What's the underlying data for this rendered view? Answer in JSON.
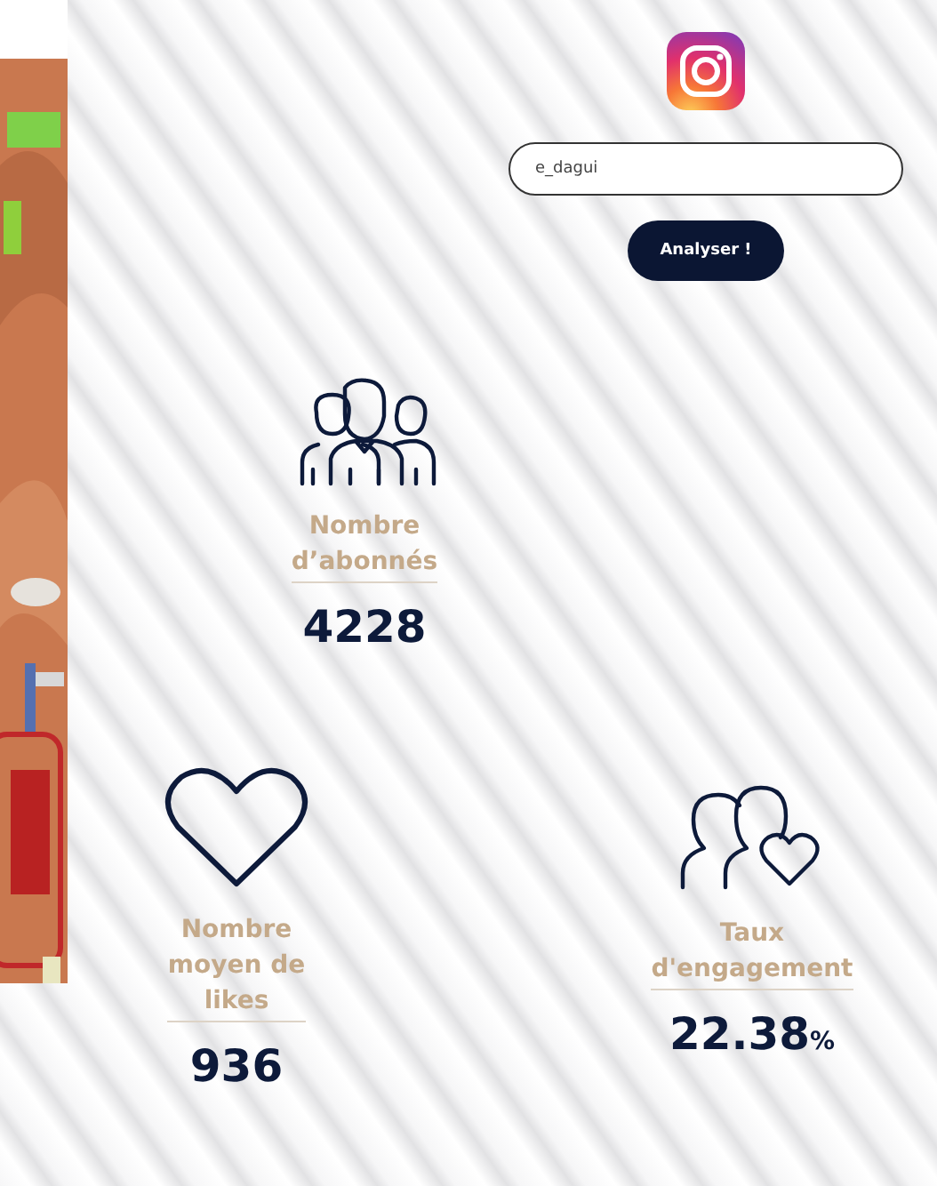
{
  "search": {
    "value": "e_dagui"
  },
  "analyze_button": {
    "label": "Analyser !"
  },
  "stats": [
    {
      "kind": "followers",
      "label_lines": [
        "Nombre",
        "d’abonnés"
      ],
      "value": "4228"
    },
    {
      "kind": "likes",
      "label_lines": [
        "Nombre",
        "moyen de",
        "likes"
      ],
      "value": "936"
    },
    {
      "kind": "engagement",
      "label_lines": [
        "Taux",
        "d'engagement"
      ],
      "value": "22.38",
      "unit": "%"
    }
  ]
}
